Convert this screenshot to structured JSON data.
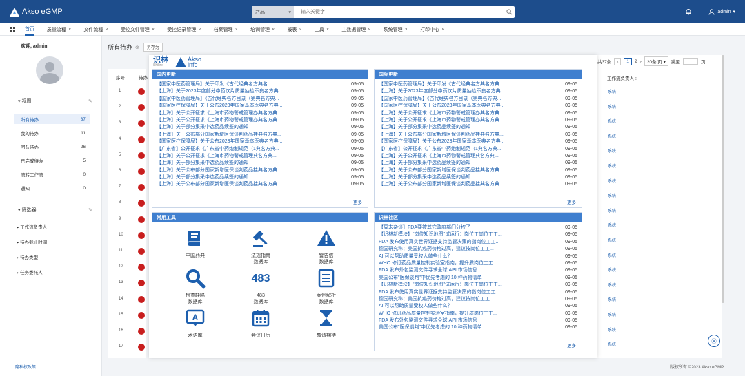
{
  "app": {
    "title": "Akso eGMP"
  },
  "search": {
    "category": "产品",
    "placeholder": "输入关键字"
  },
  "user": {
    "name": "admin"
  },
  "nav": {
    "items": [
      {
        "label": "首页",
        "has_chevron": false
      },
      {
        "label": "质量流程",
        "has_chevron": true
      },
      {
        "label": "文件流程",
        "has_chevron": true
      },
      {
        "label": "受控文件管理",
        "has_chevron": true
      },
      {
        "label": "受控记录管理",
        "has_chevron": true
      },
      {
        "label": "档案管理",
        "has_chevron": true
      },
      {
        "label": "培训管理",
        "has_chevron": true
      },
      {
        "label": "报表",
        "has_chevron": true
      },
      {
        "label": "工具",
        "has_chevron": true
      },
      {
        "label": "主数据管理",
        "has_chevron": true
      },
      {
        "label": "系统管理",
        "has_chevron": true
      },
      {
        "label": "打印中心",
        "has_chevron": true
      }
    ]
  },
  "sidebar": {
    "welcome": "欢迎, admin",
    "view_label": "视图",
    "items": [
      {
        "label": "所有待办",
        "count": "37"
      },
      {
        "label": "我的待办",
        "count": "11"
      },
      {
        "label": "团队待办",
        "count": "26"
      },
      {
        "label": "已完成待办",
        "count": "5"
      },
      {
        "label": "流转工作流",
        "count": "0"
      },
      {
        "label": "通知",
        "count": "0"
      }
    ],
    "filter_label": "筛选器",
    "filters": [
      "工作流负责人",
      "待办截止时间",
      "待办类型",
      "任务委托人"
    ]
  },
  "main": {
    "title": "所有待办",
    "btn": "另存为"
  },
  "table": {
    "col_seq": "序号",
    "col_status": "待办",
    "rows": [
      "1",
      "2",
      "3",
      "4",
      "5",
      "6",
      "7",
      "8",
      "9",
      "10",
      "11",
      "12",
      "13",
      "14",
      "15",
      "16",
      "17"
    ]
  },
  "pagination": {
    "total": "共37条",
    "page1": "1",
    "page2": "2",
    "size": "20条/页",
    "goto": "跳至",
    "page_unit": "页"
  },
  "right_column": {
    "header": "工作流负责人",
    "link": "系统"
  },
  "footer": {
    "left": "隐私权政策",
    "right": "版权所有 ©2023 Akso eGMP"
  },
  "overlay": {
    "logo_cn": "识林",
    "logo_en": "Shilinx",
    "logo_akso": "Akso",
    "logo_info": "info",
    "domestic": {
      "title": "国内更新",
      "more": "更多",
      "items": [
        {
          "t": "【国家中医药管理局】关于印发《古代经典名方典名...",
          "d": "09-05"
        },
        {
          "t": "【上海】关于2023年度部分中药饮片质量抽检不良名方典...",
          "d": "09-05"
        },
        {
          "t": "【国家中医药管理局】《古代经典名方目录（第典名方典...",
          "d": "09-05"
        },
        {
          "t": "【国家医疗保障局】关于公布2023年国家基本医典名方典...",
          "d": "09-05"
        },
        {
          "t": "【上海】关于公开征求《上海市药物警戒管理办典名方典...",
          "d": "09-05"
        },
        {
          "t": "【上海】关于公开征求《上海市药物警戒管理办典名方典...",
          "d": "09-05"
        },
        {
          "t": "【上海】关于部分集采中选药品续签的通知",
          "d": "09-05"
        },
        {
          "t": "【上海】关于公布部分国家新增医保谈判药品挂典名方典...",
          "d": "09-05"
        },
        {
          "t": "【国家医疗保障局】关于公布2023年国家基本医典名方典...",
          "d": "09-05"
        },
        {
          "t": "【广东省】公开征求《广东省中药炮制规范（1典名方典...",
          "d": "09-05"
        },
        {
          "t": "【上海】关于公开征求《上海市药物警戒管理典名方典...",
          "d": "09-05"
        },
        {
          "t": "【上海】关于部分集采中选药品续签的通知",
          "d": "09-05"
        },
        {
          "t": "【上海】关于公布部分国家新增医保谈判药品挂典名方典...",
          "d": "09-05"
        },
        {
          "t": "【上海】关于部分集采中选药品续签的通知",
          "d": "09-05"
        },
        {
          "t": "【上海】关于公布部分国家新增医保谈判药品挂典名方典...",
          "d": "09-05"
        }
      ]
    },
    "international": {
      "title": "国际更新",
      "more": "更多",
      "items": [
        {
          "t": "【国家中医药管理局】关于印发《古代经典名方典名方典...",
          "d": "09-05"
        },
        {
          "t": "【上海】关于2023年度部分中药饮片质量抽检不良名方典...",
          "d": "09-05"
        },
        {
          "t": "【国家中医药管理局】《古代经典名方目录（第典名方典...",
          "d": "09-05"
        },
        {
          "t": "【国家医疗保障局】关于公布2023年国家基本医典名方典...",
          "d": "09-05"
        },
        {
          "t": "【上海】关于公开征求《上海市药物警戒管理办典名方典...",
          "d": "09-05"
        },
        {
          "t": "【上海】关于公开征求《上海市药物警戒管理办典名方典...",
          "d": "09-05"
        },
        {
          "t": "【上海】关于部分集采中选药品续签的通知",
          "d": "09-05"
        },
        {
          "t": "【上海】关于公布部分国家新增医保谈判药品挂典名方典...",
          "d": "09-05"
        },
        {
          "t": "【国家医疗保障局】关于公布2023年国家基本医典名方典...",
          "d": "09-05"
        },
        {
          "t": "【广东省】公开征求《广东省中药炮制规范（1典名方典...",
          "d": "09-05"
        },
        {
          "t": "【上海】关于公开征求《上海市药物警戒管理典名方典...",
          "d": "09-05"
        },
        {
          "t": "【上海】关于部分集采中选药品续签的通知",
          "d": "09-05"
        },
        {
          "t": "【上海】关于公布部分国家新增医保谈判药品挂典名方典...",
          "d": "09-05"
        },
        {
          "t": "【上海】关于部分集采中选药品续签的通知",
          "d": "09-05"
        },
        {
          "t": "【上海】关于公布部分国家新增医保谈判药品挂典名方典...",
          "d": "09-05"
        }
      ]
    },
    "tools": {
      "title": "常用工具",
      "items": [
        {
          "l1": "中国药典",
          "l2": "",
          "icon": "book-icon"
        },
        {
          "l1": "法规指南",
          "l2": "数据库",
          "icon": "gavel-icon"
        },
        {
          "l1": "警告信",
          "l2": "数据库",
          "icon": "warning-icon"
        },
        {
          "l1": "检查缺陷",
          "l2": "数据库",
          "icon": "magnifier-icon"
        },
        {
          "l1": "483",
          "l2": "数据库",
          "icon": "483-icon",
          "num": "483"
        },
        {
          "l1": "案例解析",
          "l2": "数据库",
          "icon": "document-list-icon"
        },
        {
          "l1": "术语库",
          "l2": "",
          "icon": "glossary-icon"
        },
        {
          "l1": "会议日历",
          "l2": "",
          "icon": "calendar-icon"
        },
        {
          "l1": "敬请期待",
          "l2": "",
          "icon": "hourglass-icon"
        }
      ]
    },
    "community": {
      "title": "识林社区",
      "more": "更多",
      "items": [
        {
          "t": "【周末杂谈】FDA要被其它政府部门分权了",
          "d": "09-05"
        },
        {
          "t": "【识林新模块】\"岗位知识地图\"试运行：岗位工岗位工工...",
          "d": "09-05"
        },
        {
          "t": "FDA 发布使用真实世界证据支持监管决策的指岗位工工...",
          "d": "09-05"
        },
        {
          "t": "德国研究称：美国抗癌药价格过高，建议按岗位工工...",
          "d": "09-05"
        },
        {
          "t": "AI 可以帮助质量受权人做些什么？",
          "d": "09-05"
        },
        {
          "t": "WHO 修订药品质量控制实验室指南，提升质岗位工工...",
          "d": "09-05"
        },
        {
          "t": "FDA 发布外包监测文件寻求全球 API 市场信息",
          "d": "09-05"
        },
        {
          "t": "美国公布\"医保谈判\"中优先考虑的 10 种药物清单",
          "d": "09-05"
        },
        {
          "t": "【识林新模块】\"岗位知识地图\"试运行：岗位工岗位工工...",
          "d": "09-05"
        },
        {
          "t": "FDA 发布使用真实世界证据支持监管决策的指岗位工工...",
          "d": "09-05"
        },
        {
          "t": "德国研究称：美国抗癌药价格过高，建议按岗位工工...",
          "d": "09-05"
        },
        {
          "t": "AI 可以帮助质量受权人做些什么？",
          "d": "09-05"
        },
        {
          "t": "WHO 修订药品质量控制实验室指南，提升质岗位工工...",
          "d": "09-05"
        },
        {
          "t": "FDA 发布外包监测文件寻求全球 API 市场信息",
          "d": "09-05"
        },
        {
          "t": "美国公布\"医保谈判\"中优先考虑的 10 种药物清单",
          "d": "09-05"
        }
      ]
    }
  }
}
